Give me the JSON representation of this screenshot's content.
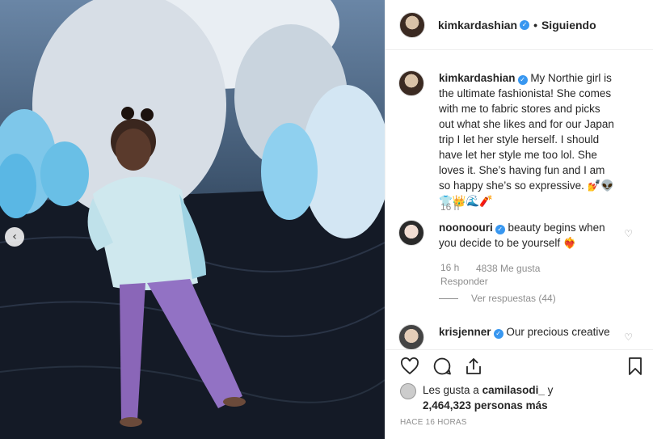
{
  "post": {
    "nav_prev_icon": "chevron-left-icon"
  },
  "header": {
    "username": "kimkardashian",
    "separator": "•",
    "follow_label": "Siguiendo"
  },
  "caption": {
    "username": "kimkardashian",
    "text": "My Northie girl is the ultimate fashionista! She comes with me to fabric stores and picks out what she likes and for our Japan trip I let her style herself. I should have let her style me too lol. She loves it. She’s having fun and I am so happy she’s so expressive. 💅👽👕👑🌊🧨",
    "time": "16 h"
  },
  "comments": [
    {
      "username": "noonoouri",
      "text": "beauty begins when you decide to be yourself ❤️‍🔥",
      "time": "16 h",
      "likes": "4838 Me gusta",
      "reply_label": "Responder",
      "view_replies": "Ver respuestas (44)"
    },
    {
      "username": "krisjenner",
      "text": "Our precious creative"
    }
  ],
  "actions": {
    "like_icon": "heart-icon",
    "comment_icon": "comment-icon",
    "share_icon": "share-icon",
    "save_icon": "bookmark-icon"
  },
  "likes": {
    "prefix": "Les gusta a",
    "user": "camilasodi_",
    "joiner": "y",
    "count": "2,464,323 personas más"
  },
  "timestamp": "HACE 16 HORAS",
  "colors": {
    "verified": "#3897f0",
    "muted": "#8e8e8e",
    "text": "#262626",
    "border": "#efefef"
  }
}
